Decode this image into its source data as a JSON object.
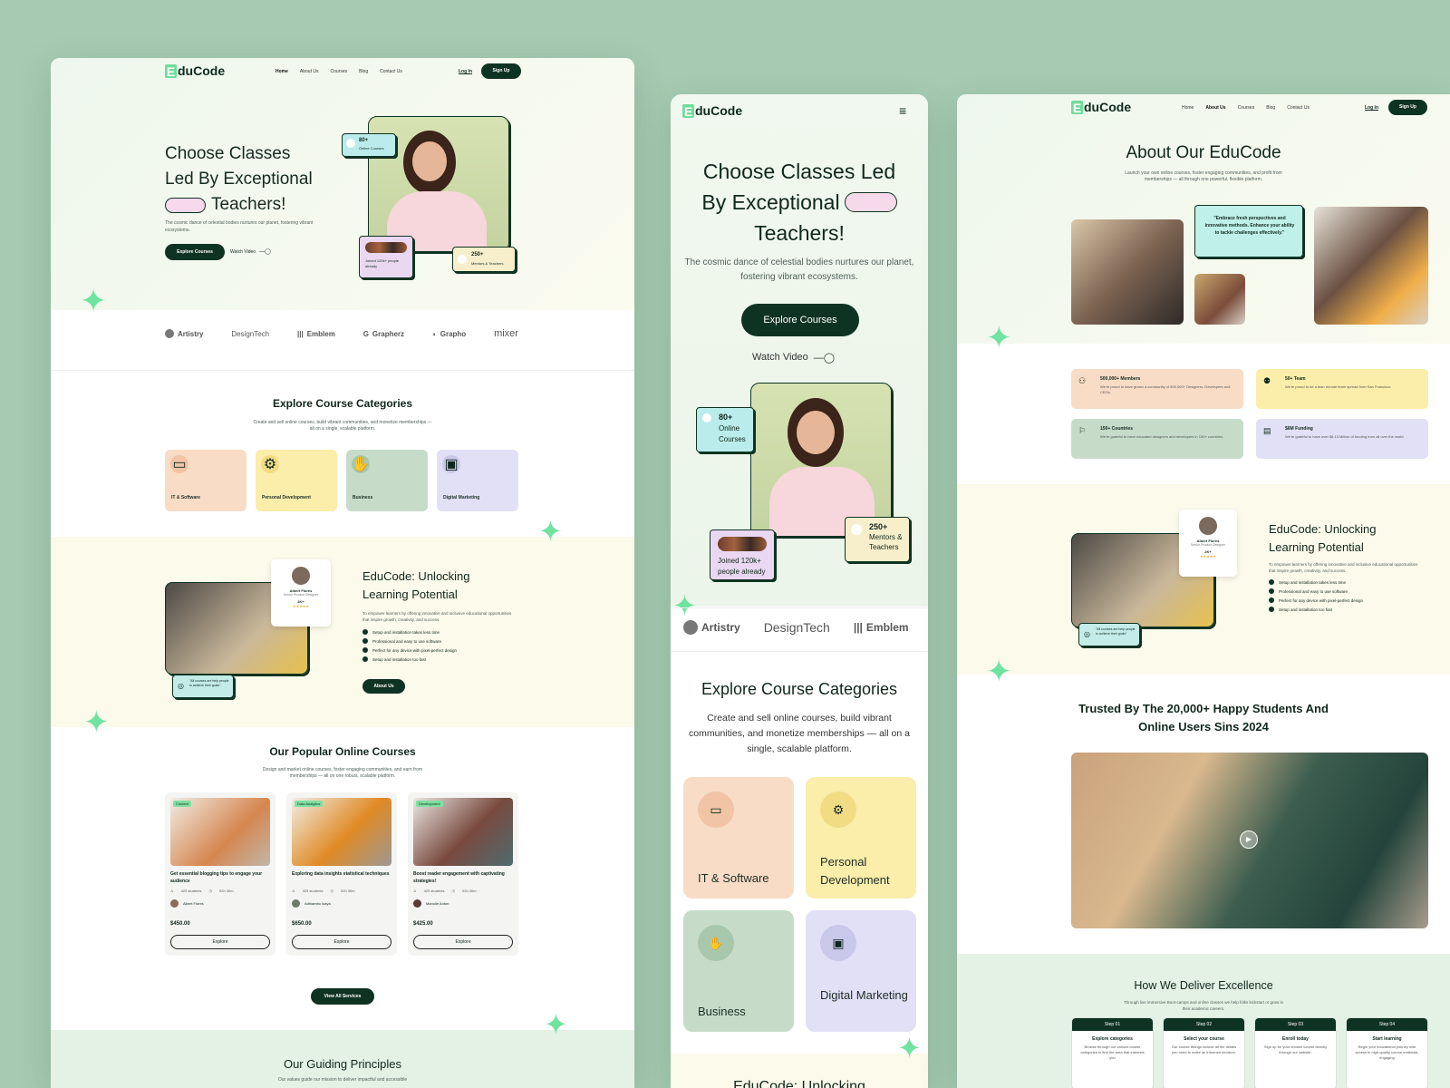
{
  "brand": {
    "logo_letter": "E",
    "logo_rest": "duCode"
  },
  "nav": {
    "home": "Home",
    "about": "About Us",
    "courses": "Courses",
    "blog": "Blog",
    "contact": "Contact Us",
    "login": "Log In",
    "signup": "Sign Up"
  },
  "hero": {
    "title_1": "Choose Classes",
    "title_2": "Led By Exceptional",
    "title_3": "Teachers!",
    "m_title_1": "Choose Classes Led",
    "m_title_2": "By Exceptional",
    "m_title_3": "Teachers!",
    "desc": "The cosmic dance of celestial bodies nurtures our planet, fostering vibrant ecosystems.",
    "cta": "Explore Courses",
    "video": "Watch Video",
    "badge_courses_num": "80+",
    "badge_courses_txt": "Online Courses",
    "badge_joined": "Joined 120k+ people already",
    "badge_mentors_num": "250+",
    "badge_mentors_txt": "Mentors & Teachers"
  },
  "brands": [
    "Artistry",
    "DesignTech",
    "Emblem",
    "Grapherz",
    "Grapho",
    "mixer"
  ],
  "categories": {
    "title": "Explore Course Categories",
    "desc": "Create and sell online courses, build vibrant communities, and monetize memberships — all on a single, scalable platform.",
    "items": [
      {
        "label": "IT & Software",
        "color": "#f9dcc6"
      },
      {
        "label": "Personal Development",
        "color": "#fbedaa"
      },
      {
        "label": "Business",
        "color": "#c6dcc9"
      },
      {
        "label": "Digital Marketing",
        "color": "#e1e0f6"
      }
    ]
  },
  "unlock": {
    "title_1": "EduCode: Unlocking",
    "title_2": "Learning Potential",
    "desc": "To empower learners by offering innovative and inclusive educational opportunities that inspire growth, creativity, and success.",
    "points": [
      "Setup and installation takes less time",
      "Professional and easy to use software",
      "Perfect for any device with pixel-perfect design",
      "Setup and installation too fast"
    ],
    "cta": "About Us",
    "mentor_name": "Albert Flores",
    "mentor_role": "Senior Product Designer",
    "mentor_count": "2K+",
    "stars": "★★★★★",
    "quote": "\"All courses are help people to achieve their goals\""
  },
  "popular": {
    "title": "Our Popular Online Courses",
    "desc": "Design and market online courses, foster engaging communities, and earn from memberships — all on one robust, scalable platform.",
    "courses": [
      {
        "tag": "Content",
        "title": "Get essential blogging tips to engage your audience",
        "students": "423 students",
        "time": "02h 30m",
        "author": "Albert Flores",
        "price": "$450.00",
        "btn": "Explore"
      },
      {
        "tag": "Data Analytics",
        "title": "Exploring data insights statistical techniques",
        "students": "423 students",
        "time": "02h 30m",
        "author": "Adhiambo Isaya",
        "price": "$650.00",
        "btn": "Explore"
      },
      {
        "tag": "Development",
        "title": "Boost reader engagement with captivating strategies!",
        "students": "423 students",
        "time": "02h 30m",
        "author": "Manolie Anton",
        "price": "$425.00",
        "btn": "Explore"
      }
    ],
    "view_all": "View All Services"
  },
  "principles": {
    "title": "Our Guiding Principles",
    "desc": "Our values guide our mission to deliver impactful and accessible"
  },
  "mobile_next": "EduCode: Unlocking",
  "about": {
    "title": "About Our EduCode",
    "desc": "Launch your own online courses, foster engaging communities, and profit from memberships — all through one powerful, flexible platform.",
    "quote": "\"Embrace fresh perspectives and innovative methods. Enhance your ability to tackle challenges effectively.\"",
    "stats": [
      {
        "title": "500,000+ Members",
        "desc": "We're proud to have grown a community of 500,000+ Designers, Developers and CEOs.",
        "color": "#f9dcc6"
      },
      {
        "title": "50+ Team",
        "desc": "We're proud to be a lean remote team spread from San Francisco.",
        "color": "#fbedaa"
      },
      {
        "title": "150+ Countries",
        "desc": "We're grateful to have educated designers and developers in 150+ countries.",
        "color": "#c6dcc9"
      },
      {
        "title": "$6M Funding",
        "desc": "We're grateful to have over $6.13 Million of funding from all over the world.",
        "color": "#e1e0f6"
      }
    ],
    "trusted_1": "Trusted By The 20,000+ Happy Students And",
    "trusted_2": "Online Users Sins 2024",
    "excellence_title": "How We Deliver Excellence",
    "excellence_desc": "Through live immersive Boot-camps and online classes we help folks kickstart or grow in their academic careers.",
    "steps": [
      {
        "num": "Step 01",
        "title": "Explore categories",
        "desc": "Browse through our various course categories to find the area that interests you"
      },
      {
        "num": "Step 02",
        "title": "Select your course",
        "desc": "Our course listings include all the details you need to make an informed decision."
      },
      {
        "num": "Step 03",
        "title": "Enroll today",
        "desc": "Sign up for your chosen course directly through our website."
      },
      {
        "num": "Step 04",
        "title": "Start learning",
        "desc": "Begin your educational journey with access to high-quality course materials, engaging"
      }
    ]
  },
  "colors": {
    "dark": "#0f3322",
    "mint": "#6fdc9a",
    "page_bg": "#a6cbb2"
  },
  "icons": {
    "menu": "hamburger-icon",
    "spark": "sparkle-icon",
    "check": "check-icon",
    "play": "play-icon"
  }
}
